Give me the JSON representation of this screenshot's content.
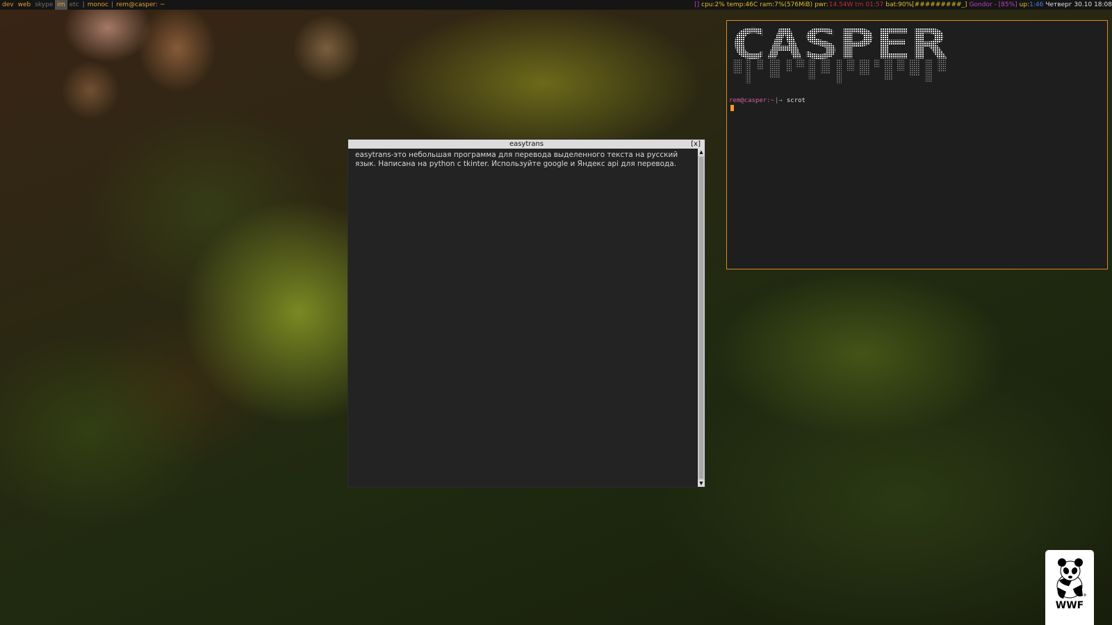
{
  "topbar": {
    "tags": [
      {
        "label": "dev",
        "state": "normal"
      },
      {
        "label": "web",
        "state": "normal"
      },
      {
        "label": "skype",
        "state": "dim"
      },
      {
        "label": "im",
        "state": "active"
      },
      {
        "label": "etc",
        "state": "dim"
      }
    ],
    "separator": "|",
    "layout": "monoc",
    "window_title": "rem@casper: ~",
    "status": [
      {
        "text": "[]",
        "color": "#c040c0"
      },
      {
        "text": "cpu:2%",
        "color": "#e0c020"
      },
      {
        "text": "temp:46C",
        "color": "#e0c020"
      },
      {
        "text": "ram:7%(576MiB)",
        "color": "#e0c020"
      },
      {
        "text": "pwr:",
        "color": "#e0c020"
      },
      {
        "text": "14.54W tm 01:57",
        "color": "#c03030"
      },
      {
        "text": "bat:90%[#########_]",
        "color": "#e0c020"
      },
      {
        "text": "Gondor - [85%]",
        "color": "#c040c0"
      },
      {
        "text": "up:",
        "color": "#e0c020"
      },
      {
        "text": "1:46",
        "color": "#4080e0"
      },
      {
        "text": "Четверг 30.10 18:08",
        "color": "#e0e0e0"
      }
    ]
  },
  "easytrans": {
    "title": "easytrans",
    "close_label": "[x]",
    "body": "easytrans-это небольшая программа для перевода выделенного текста на русский язык. Написана на python с tkinter. Используйте google и Яндекс api для перевода.",
    "scroll_up": "▲",
    "scroll_down": "▼"
  },
  "terminal": {
    "banner": "CASPER",
    "prompt_user": "rem@casper:~",
    "prompt_symbol": "|→",
    "command": "scrot",
    "cursor_color": "#ff9a20"
  },
  "wwf_logo": {
    "text": "WWF",
    "mark": "®"
  },
  "colors": {
    "topbar_bg": "#151515",
    "accent": "#e0a030",
    "terminal_border": "#e08a20",
    "window_bg": "#232323"
  }
}
